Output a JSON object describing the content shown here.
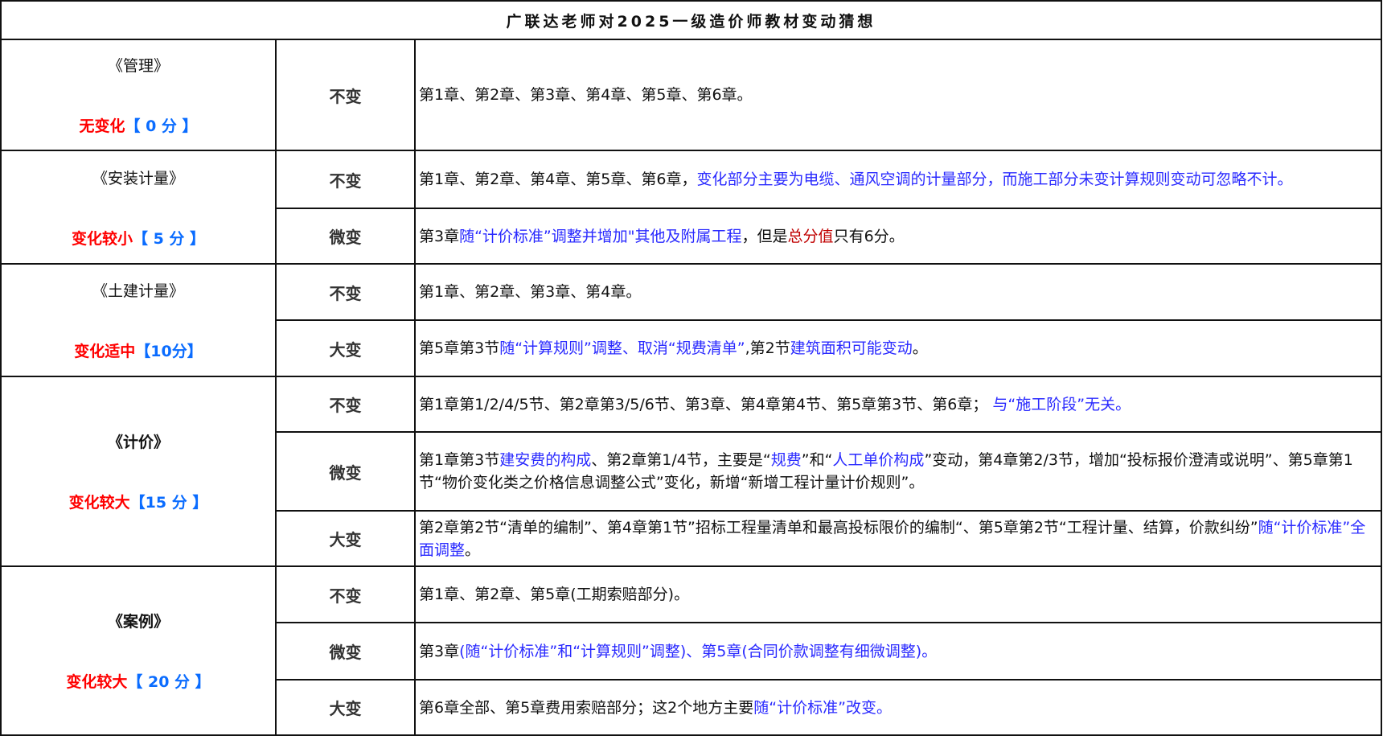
{
  "title": "广联达老师对2025一级造价师教材变动猜想",
  "colors": {
    "black": "#111111",
    "blue": "#2a2aff",
    "darkred": "#c00000",
    "red": "#ff0000",
    "score_blue": "#0a6cff"
  },
  "subjects": [
    {
      "name": "《管理》",
      "bold": false,
      "score_red": "无变化",
      "score_blue": "【 0 分 】",
      "rows": [
        {
          "level": "不变",
          "content": [
            {
              "t": "第1章、第2章、第3章、第4章、第5章、第6章。",
              "c": "black"
            }
          ]
        }
      ]
    },
    {
      "name": "《安装计量》",
      "bold": false,
      "score_red": "变化较小",
      "score_blue": "【 5 分 】",
      "rows": [
        {
          "level": "不变",
          "content": [
            {
              "t": "第1章、第2章、第4章、第5章、第6章，",
              "c": "black"
            },
            {
              "t": "变化部分主要为电缆、通风空调的计量部分，而施工部分未变计算规则变动可忽略不计。",
              "c": "blue"
            }
          ]
        },
        {
          "level": "微变",
          "content": [
            {
              "t": "第3章",
              "c": "black"
            },
            {
              "t": "随“计价标准”调整并增加\"其他及附属工程",
              "c": "blue"
            },
            {
              "t": "，但是",
              "c": "black"
            },
            {
              "t": "总分值",
              "c": "darkred"
            },
            {
              "t": "只有6分。",
              "c": "black"
            }
          ]
        }
      ]
    },
    {
      "name": "《土建计量》",
      "bold": false,
      "score_red": "变化适中",
      "score_blue": "【10分】",
      "rows": [
        {
          "level": "不变",
          "content": [
            {
              "t": "第1章、第2章、第3章、第4章。",
              "c": "black"
            }
          ]
        },
        {
          "level": "大变",
          "content": [
            {
              "t": "第5章第3节",
              "c": "black"
            },
            {
              "t": "随“计算规则”调整、取消“规费清单”",
              "c": "blue"
            },
            {
              "t": ",第2节",
              "c": "black"
            },
            {
              "t": "建筑面积可能变动",
              "c": "blue"
            },
            {
              "t": "。",
              "c": "black"
            }
          ]
        }
      ]
    },
    {
      "name": "《计价》",
      "bold": true,
      "score_red": "变化较大",
      "score_blue": "【15 分 】",
      "rows": [
        {
          "level": "不变",
          "content": [
            {
              "t": "第1章第1/2/4/5节、第2章第3/5/6节、第3章、第4章第4节、第5章第3节、第6章；",
              "c": "black"
            },
            {
              "t": " 与“施工阶段”无关。",
              "c": "blue"
            }
          ]
        },
        {
          "level": "微变",
          "content": [
            {
              "t": "第1章第3节",
              "c": "black"
            },
            {
              "t": "建安费的构成",
              "c": "blue"
            },
            {
              "t": "、第2章第1/4节，主要是“",
              "c": "black"
            },
            {
              "t": "规费",
              "c": "blue"
            },
            {
              "t": "”和“",
              "c": "black"
            },
            {
              "t": "人工单价构成",
              "c": "blue"
            },
            {
              "t": "”变动，第4章第2/3节，增加“投标报价澄清或说明”、第5章第1节“物价变化类之价格信息调整公式”变化，新增“新增工程计量计价规则”。",
              "c": "black"
            }
          ]
        },
        {
          "level": "大变",
          "top": true,
          "content": [
            {
              "t": "第2章第2节“清单的编制”、第4章第1节”招标工程量清单和最高投标限价的编制“、第5章第2节“工程计量、结算，价款纠纷”",
              "c": "black"
            },
            {
              "t": "随“计价标准”全面调整",
              "c": "blue"
            },
            {
              "t": "。",
              "c": "black"
            }
          ]
        }
      ]
    },
    {
      "name": "《案例》",
      "bold": true,
      "score_red": "变化较大",
      "score_blue": "【 20 分 】",
      "rows": [
        {
          "level": "不变",
          "content": [
            {
              "t": "第1章、第2章、第5章(工期索赔部分)。",
              "c": "black"
            }
          ]
        },
        {
          "level": "微变",
          "content": [
            {
              "t": "第3章",
              "c": "black"
            },
            {
              "t": "(随“计价标准”和“计算规则”调整)、第5章(合同价款调整有细微调整)。",
              "c": "blue"
            }
          ]
        },
        {
          "level": "大变",
          "content": [
            {
              "t": "第6章全部、第5章费用索赔部分；这2个地方主要",
              "c": "black"
            },
            {
              "t": "随“计价标准”改变。",
              "c": "blue"
            }
          ]
        }
      ]
    }
  ]
}
